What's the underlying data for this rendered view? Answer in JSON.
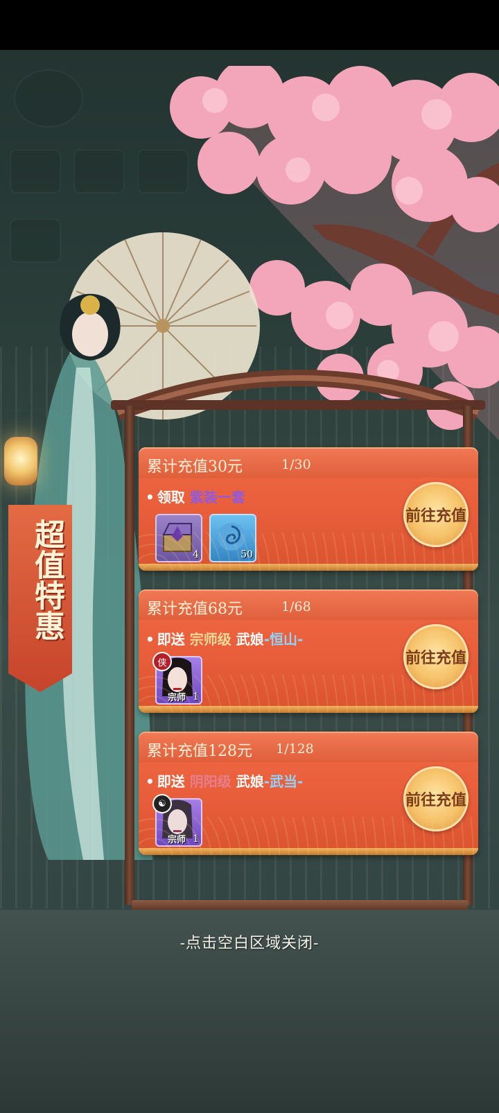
{
  "banner": {
    "text": "超值特惠"
  },
  "cards": [
    {
      "title": "累计充值30元",
      "progress": "1/30",
      "desc_prefix": "领取",
      "desc_highlight": "紫装一套",
      "button": "前往充值",
      "items": [
        {
          "icon": "treasure-chest-icon",
          "count": "4"
        },
        {
          "icon": "swirl-orb-icon",
          "count": "50"
        }
      ]
    },
    {
      "title": "累计充值68元",
      "progress": "1/68",
      "desc_prefix": "即送",
      "desc_rank": "宗师级",
      "desc_role": "武娘",
      "desc_name": "-恒山-",
      "button": "前往充值",
      "hero": {
        "icon": "hero-portrait-icon",
        "badge": "侠",
        "tag": "宗师",
        "count": "1"
      }
    },
    {
      "title": "累计充值128元",
      "progress": "1/128",
      "desc_prefix": "即送",
      "desc_rank": "阴阳级",
      "desc_role": "武娘",
      "desc_name": "-武当-",
      "button": "前往充值",
      "hero": {
        "icon": "hero-portrait-icon",
        "badge": "☯",
        "tag": "宗师",
        "count": "1"
      }
    }
  ],
  "close_hint": "-点击空白区域关闭-",
  "colors": {
    "card": "#e85d3a",
    "button": "#f6c269",
    "rank_purple": "#8f5ae0",
    "rank_pink": "#e77d8d",
    "name_blue": "#8fd3ff"
  }
}
